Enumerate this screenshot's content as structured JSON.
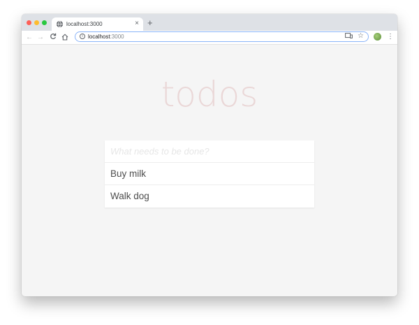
{
  "browser": {
    "tab": {
      "title": "localhost:3000",
      "close": "×"
    },
    "new_tab": "+",
    "nav": {
      "back": "←",
      "forward": "→",
      "reload": "C",
      "home": "⌂"
    },
    "address": {
      "host": "localhost",
      "port": ":3000"
    },
    "menu": "⋮"
  },
  "app": {
    "title": "todos",
    "new_todo_placeholder": "What needs to be done?",
    "items": [
      {
        "label": "Buy milk"
      },
      {
        "label": "Walk dog"
      }
    ]
  }
}
